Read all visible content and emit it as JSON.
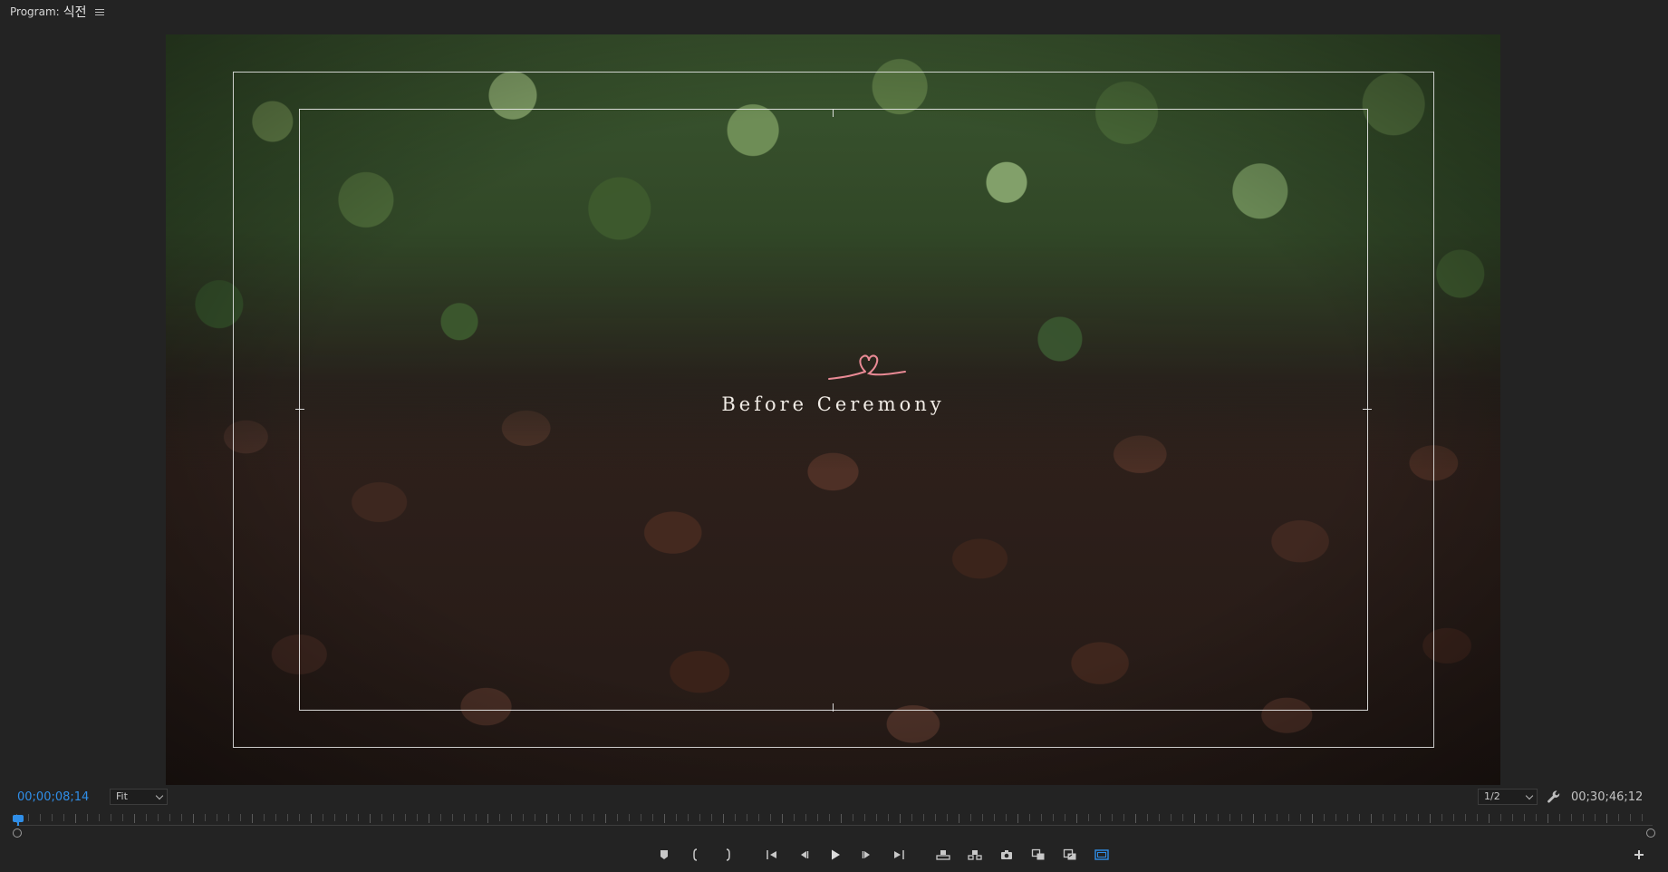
{
  "panel": {
    "title_prefix": "Program:",
    "sequence_name": "식전"
  },
  "video": {
    "overlay_title": "Before Ceremony",
    "accent_color": "#e98a95"
  },
  "controls": {
    "current_timecode": "00;00;08;14",
    "zoom_level": "Fit",
    "playback_resolution": "1/2",
    "duration_timecode": "00;30;46;12"
  },
  "icons": {
    "panel_menu": "hamburger-menu-icon",
    "wrench": "wrench-icon",
    "add": "plus-icon",
    "transport": [
      "add-marker-icon",
      "mark-in-icon",
      "mark-out-icon",
      "go-to-in-icon",
      "step-back-icon",
      "play-icon",
      "step-forward-icon",
      "go-to-out-icon",
      "lift-icon",
      "extract-icon",
      "export-frame-icon",
      "comparison-view-icon",
      "proxy-toggle-icon",
      "safe-margins-icon"
    ]
  },
  "colors": {
    "timecode_blue": "#2f8ee8",
    "panel_bg": "#232323",
    "active_toggle": "#2f8ee8"
  }
}
